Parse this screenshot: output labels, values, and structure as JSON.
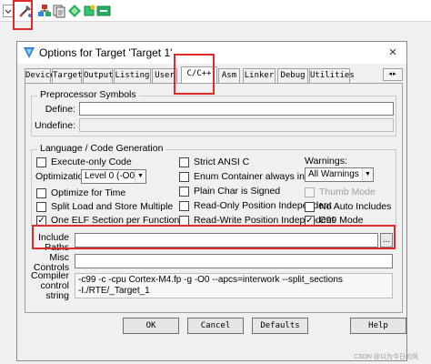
{
  "toolbar": {
    "icons": [
      "dropdown-arrow-icon",
      "options-for-target-icon",
      "manage-project-items-icon",
      "file-extensions-icon",
      "select-packs-icon",
      "manage-run-time-environment-icon"
    ]
  },
  "dialog": {
    "title": "Options for Target 'Target 1'",
    "close_label": "×",
    "tabs": [
      "Device",
      "Target",
      "Output",
      "Listing",
      "User",
      "C/C++",
      "Asm",
      "Linker",
      "Debug",
      "Utilities"
    ],
    "active_tab": "C/C++",
    "tab_scroll": "◂▸",
    "preprocessor": {
      "group_title": "Preprocessor Symbols",
      "define_label": "Define:",
      "define_value": "",
      "undefine_label": "Undefine:",
      "undefine_value": ""
    },
    "language": {
      "group_title": "Language / Code Generation",
      "execute_only": {
        "label": "Execute-only Code",
        "checked": false
      },
      "optimization_label": "Optimization:",
      "optimization_value": "Level 0 (-O0)",
      "optimize_time": {
        "label": "Optimize for Time",
        "checked": false
      },
      "split_load_store": {
        "label": "Split Load and Store Multiple",
        "checked": false
      },
      "one_elf": {
        "label": "One ELF Section per Function",
        "checked": true
      },
      "strict_ansi": {
        "label": "Strict ANSI C",
        "checked": false
      },
      "enum_int": {
        "label": "Enum Container always int",
        "checked": false
      },
      "plain_char": {
        "label": "Plain Char is Signed",
        "checked": false
      },
      "readonly_pi": {
        "label": "Read-Only Position Independent",
        "checked": false
      },
      "readwrite_pi": {
        "label": "Read-Write Position Independent",
        "checked": false
      },
      "warnings_label": "Warnings:",
      "warnings_value": "All Warnings",
      "thumb_mode": {
        "label": "Thumb Mode",
        "checked": false
      },
      "no_auto_includes": {
        "label": "No Auto Includes",
        "checked": false
      },
      "c99_mode": {
        "label": "C99 Mode",
        "checked": true
      }
    },
    "include_paths_label": "Include Paths",
    "include_paths_value": "",
    "browse_label": "...",
    "misc_controls_label": "Misc Controls",
    "misc_controls_value": "",
    "compiler_control_label": "Compiler control string",
    "compiler_control_line1": "-c99 -c -cpu Cortex-M4.fp -g -O0 --apcs=interwork --split_sections",
    "compiler_control_line2": "-I./RTE/_Target_1",
    "buttons": {
      "ok": "OK",
      "cancel": "Cancel",
      "defaults": "Defaults",
      "help": "Help"
    }
  },
  "watermark": "CSDN @以为今日的风",
  "colors": {
    "highlight": "#e02a2a"
  }
}
